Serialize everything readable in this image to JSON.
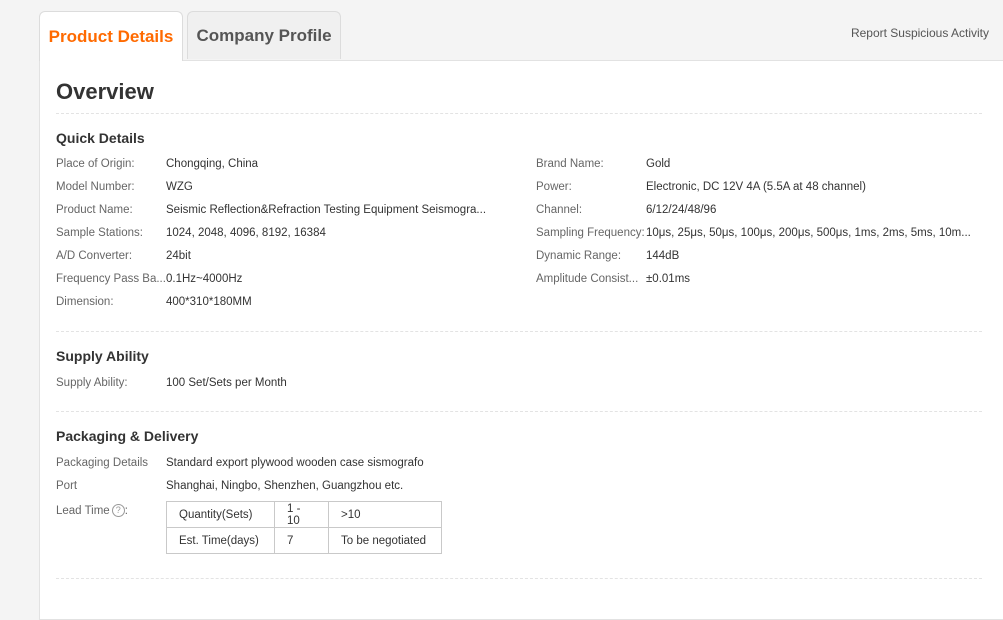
{
  "tabs": {
    "active_label": "Product Details",
    "inactive_label": "Company Profile"
  },
  "report_link": "Report Suspicious Activity",
  "overview_title": "Overview",
  "quick_details": {
    "title": "Quick Details",
    "left": [
      {
        "label": "Place of Origin:",
        "value": "Chongqing, China"
      },
      {
        "label": "Model Number:",
        "value": "WZG"
      },
      {
        "label": "Product Name:",
        "value": "Seismic Reflection&Refraction Testing Equipment Seismogra..."
      },
      {
        "label": "Sample Stations:",
        "value": "1024, 2048, 4096, 8192, 16384"
      },
      {
        "label": "A/D Converter:",
        "value": "24bit"
      },
      {
        "label": "Frequency Pass Ba...",
        "value": "0.1Hz~4000Hz"
      },
      {
        "label": "Dimension:",
        "value": "400*310*180MM"
      }
    ],
    "right": [
      {
        "label": "Brand Name:",
        "value": "Gold"
      },
      {
        "label": "Power:",
        "value": "Electronic, DC 12V 4A (5.5A at 48 channel)"
      },
      {
        "label": "Channel:",
        "value": "6/12/24/48/96"
      },
      {
        "label": "Sampling Frequency:",
        "value": "10μs, 25μs, 50μs, 100μs, 200μs, 500μs, 1ms, 2ms, 5ms, 10m..."
      },
      {
        "label": "Dynamic Range:",
        "value": "144dB"
      },
      {
        "label": "Amplitude Consist...",
        "value": "±0.01ms"
      }
    ]
  },
  "supply": {
    "title": "Supply Ability",
    "label": "Supply Ability:",
    "value": "100 Set/Sets per Month"
  },
  "packaging": {
    "title": "Packaging & Delivery",
    "details_label": "Packaging Details",
    "details_value": "Standard export plywood wooden case sismografo",
    "port_label": "Port",
    "port_value": "Shanghai, Ningbo, Shenzhen, Guangzhou etc.",
    "lead_label": "Lead Time",
    "lead_colon": ":",
    "help_glyph": "?",
    "lead_table": [
      [
        "Quantity(Sets)",
        "1 - 10",
        ">10"
      ],
      [
        "Est. Time(days)",
        "7",
        "To be negotiated"
      ]
    ]
  },
  "colors": {
    "accent": "#ff6a00"
  }
}
